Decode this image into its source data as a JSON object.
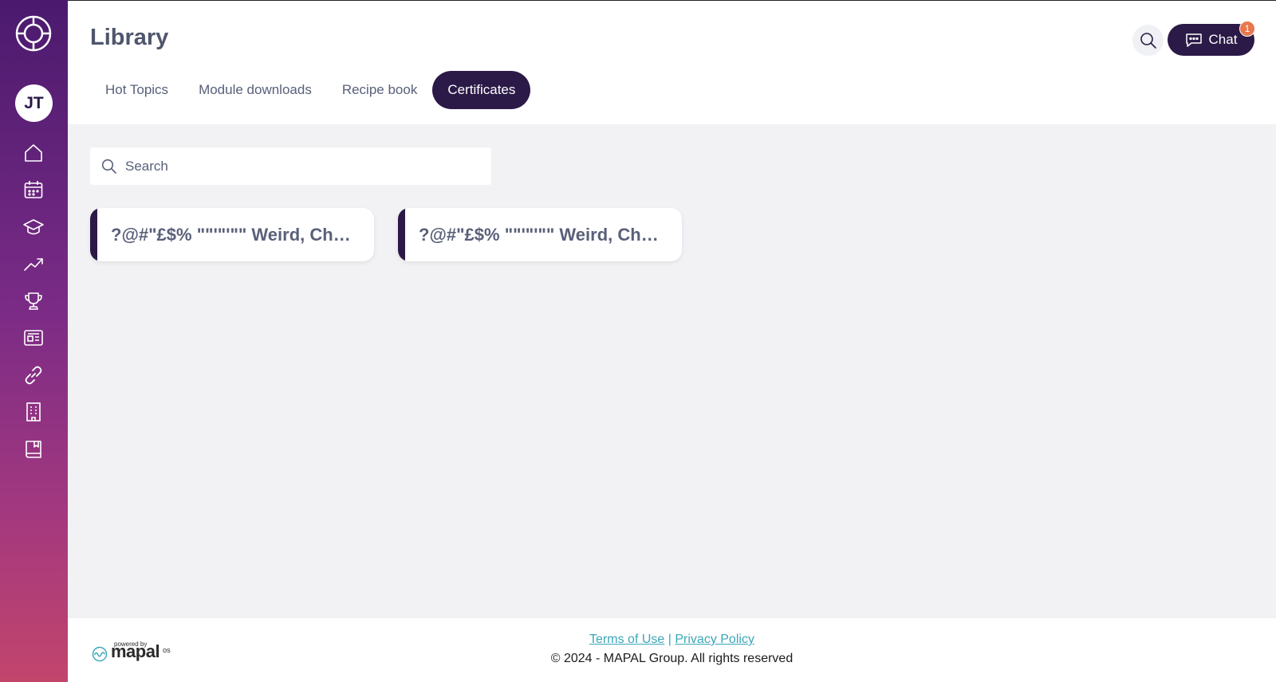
{
  "sidebar": {
    "avatar_initials": "JT",
    "nav_icons": [
      "home-icon",
      "calendar-icon",
      "graduation-cap-icon",
      "trending-up-icon",
      "trophy-icon",
      "news-icon",
      "link-icon",
      "building-icon",
      "book-icon"
    ]
  },
  "header": {
    "title": "Library",
    "tabs": [
      {
        "label": "Hot Topics",
        "active": false
      },
      {
        "label": "Module downloads",
        "active": false
      },
      {
        "label": "Recipe book",
        "active": false
      },
      {
        "label": "Certificates",
        "active": true
      }
    ],
    "chat_label": "Chat",
    "chat_badge": "1"
  },
  "main": {
    "search_placeholder": "Search",
    "cards": [
      {
        "title": "?@#\"£$% \"\"'\"'\"\" Weird, Characters"
      },
      {
        "title": "?@#\"£$% \"\"'\"'\"\" Weird, Characters"
      }
    ]
  },
  "footer": {
    "powered_by": "powered by",
    "brand": "mapal",
    "brand_suffix": "os",
    "terms_label": "Terms of Use",
    "separator": "|",
    "privacy_label": "Privacy Policy",
    "copyright": "© 2024 - MAPAL Group. All rights reserved"
  },
  "colors": {
    "primary": "#2b1a47",
    "link": "#3aa7b9",
    "badge": "#e8774e",
    "background": "#f2f2f5"
  }
}
